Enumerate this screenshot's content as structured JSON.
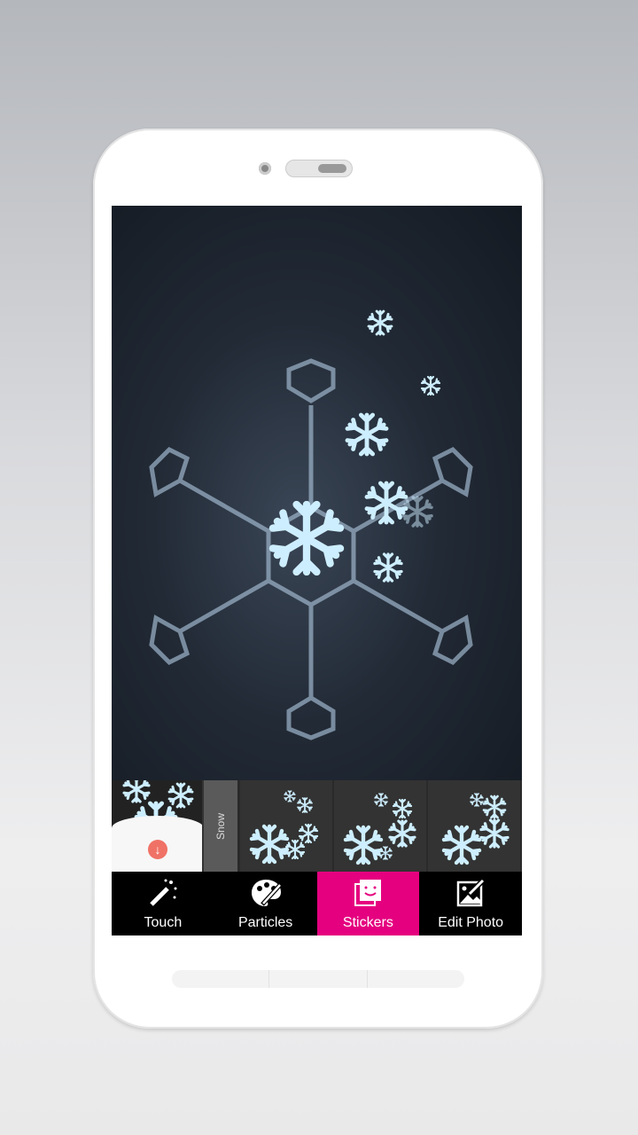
{
  "sticker_strip": {
    "category_label": "Snow",
    "packs": [
      "snow-pack-1",
      "snow-pack-2",
      "snow-pack-3"
    ]
  },
  "toolbar": {
    "tabs": [
      {
        "label": "Touch",
        "icon": "magic-wand-icon"
      },
      {
        "label": "Particles",
        "icon": "palette-icon"
      },
      {
        "label": "Stickers",
        "icon": "sticker-icon",
        "active": true
      },
      {
        "label": "Edit Photo",
        "icon": "edit-photo-icon"
      }
    ]
  },
  "colors": {
    "active_tab": "#e5007f",
    "download_badge": "#f07266"
  }
}
